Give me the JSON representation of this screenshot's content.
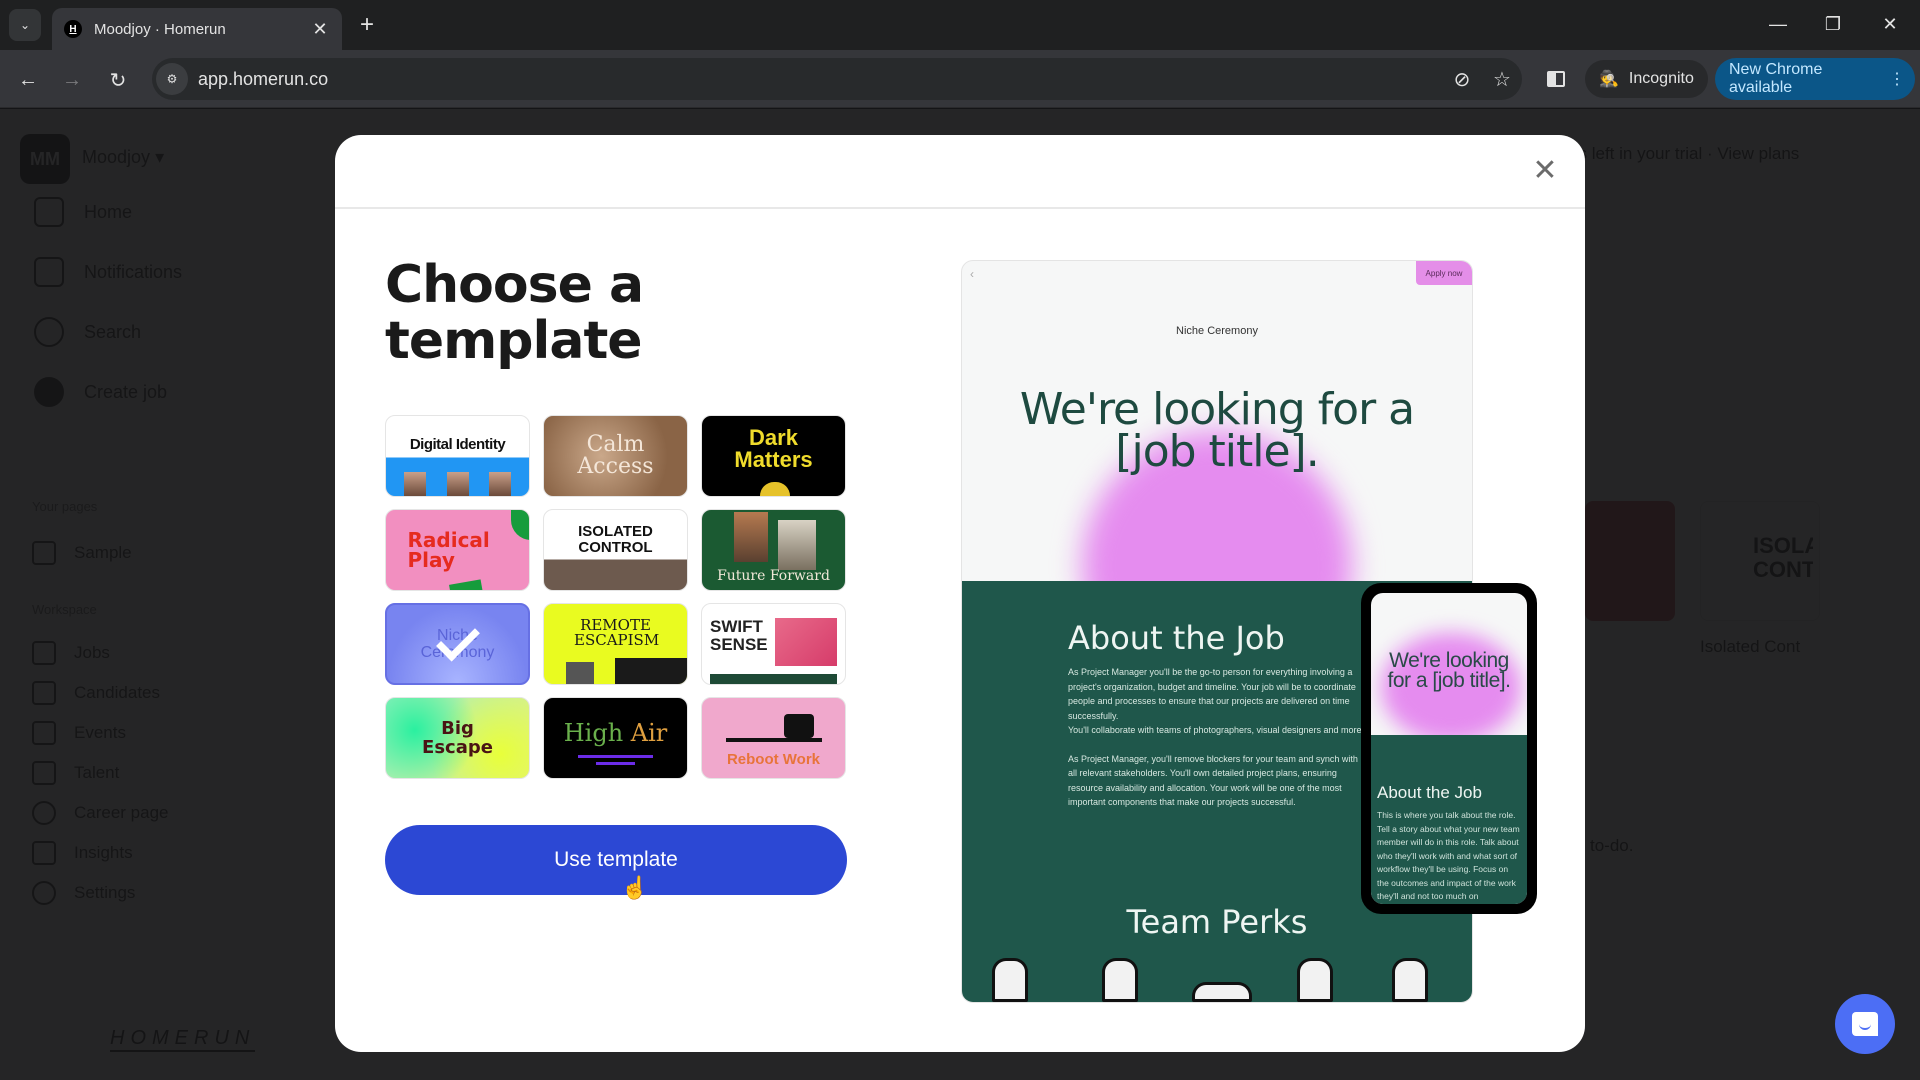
{
  "browser": {
    "tab_title": "Moodjoy · Homerun",
    "tab_favicon_letter": "H",
    "url": "app.homerun.co",
    "incognito_label": "Incognito",
    "update_label": "New Chrome available",
    "icons": {
      "tab_search": "chevron-down-icon",
      "close_tab": "close-icon",
      "new_tab": "plus-icon",
      "back": "arrow-left-icon",
      "forward": "arrow-right-icon",
      "reload": "reload-icon",
      "site_info": "tune-icon",
      "eye_off": "eye-off-icon",
      "bookmark": "star-icon",
      "side_panel": "side-panel-icon",
      "incognito": "incognito-icon",
      "menu": "kebab-menu-icon",
      "minimize": "minimize-icon",
      "restore": "restore-icon",
      "close_window": "close-icon"
    }
  },
  "background_app": {
    "workspace_initials": "MM",
    "workspace_name": "Moodjoy",
    "nav": [
      "Home",
      "Notifications",
      "Search",
      "Create job"
    ],
    "pages_heading": "Your pages",
    "pages": [
      "Sample"
    ],
    "workspace_heading": "Workspace",
    "workspace_items": [
      "Jobs",
      "Candidates",
      "Events",
      "Talent",
      "Career page",
      "Insights",
      "Settings"
    ],
    "logo_text": "HOMERUN",
    "trial_text": "ys left in your trial · View plans",
    "bg_card_label": "Isolated Cont",
    "bg_card_title": "ISOLA CONT",
    "bg_todo_text": "to-do."
  },
  "modal": {
    "title_line1": "Choose a",
    "title_line2": "template",
    "use_button": "Use template",
    "selected_template": "Niche Ceremony",
    "templates": [
      {
        "name": "Digital Identity",
        "selected": false
      },
      {
        "name": "Calm Access",
        "selected": false
      },
      {
        "name": "Dark Matters",
        "selected": false
      },
      {
        "name": "Radical Play",
        "selected": false
      },
      {
        "name": "ISOLATED CONTROL",
        "selected": false
      },
      {
        "name": "Future Forward",
        "selected": false
      },
      {
        "name": "Niche Ceremony",
        "selected": true
      },
      {
        "name": "REMOTE ESCAPISM",
        "selected": false
      },
      {
        "name": "SWIFT SENSE",
        "selected": false
      },
      {
        "name": "Big Escape",
        "selected": false
      },
      {
        "name": "High Air",
        "selected": false
      },
      {
        "name": "Reboot Work",
        "selected": false
      }
    ],
    "colors": {
      "use_button": "#2c48d4",
      "preview_green": "#1f574b",
      "preview_pink": "#e58cef"
    }
  },
  "preview": {
    "apply_label": "Apply now",
    "company": "Niche Ceremony",
    "hero": "We're looking for a [job title].",
    "about_title": "About the Job",
    "about_p1": "As Project Manager you'll be the go-to person for everything involving a project's organization, budget and timeline. Your job will be to coordinate people and processes to ensure that our projects are delivered on time successfully.",
    "about_p1b": "You'll collaborate with teams of photographers, visual designers and more.",
    "about_p2": "As Project Manager, you'll remove blockers for your team and synch with all relevant stakeholders. You'll own detailed project plans, ensuring resource availability and allocation. Your work will be one of the most important components that make our projects successful.",
    "perks_title": "Team Perks",
    "mobile": {
      "hero": "We're looking for a [job title].",
      "about_title": "About the Job",
      "about_body": "This is where you talk about the role. Tell a story about what your new team member will do in this role. Talk about who they'll work with and what sort of workflow they'll be using. Focus on the outcomes and impact of the work they'll and not too much on"
    }
  }
}
